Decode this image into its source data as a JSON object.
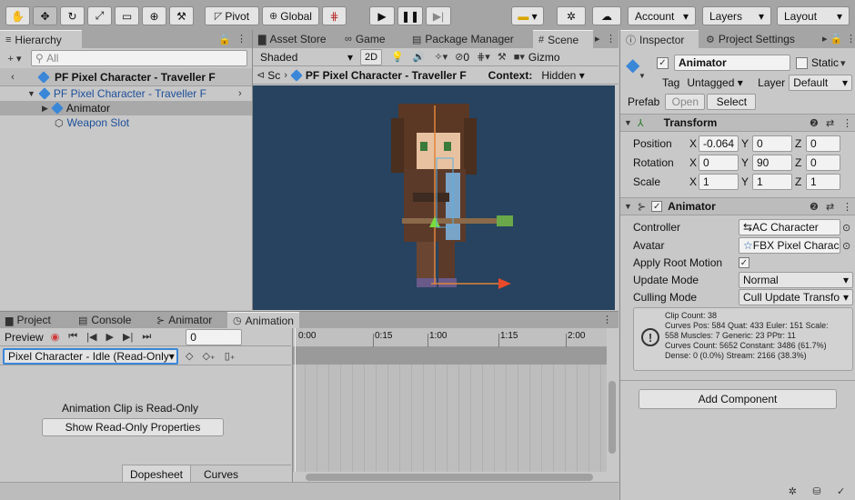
{
  "toolbar": {
    "pivot": "Pivot",
    "global": "Global",
    "account": "Account",
    "layers": "Layers",
    "layout": "Layout"
  },
  "hierarchy": {
    "tab": "Hierarchy",
    "search_placeholder": "All",
    "scene_title": "PF Pixel Character - Traveller F",
    "items": [
      {
        "label": "PF Pixel Character - Traveller F"
      },
      {
        "label": "Animator"
      },
      {
        "label": "Weapon Slot"
      }
    ]
  },
  "scene": {
    "tabs": [
      "Asset Store",
      "Game",
      "Package Manager",
      "Scene"
    ],
    "shading": "Shaded",
    "mode_2d": "2D",
    "gizmos": "Gizmo",
    "layer_count": "0",
    "breadcrumb_sc": "Sc",
    "breadcrumb_title": "PF Pixel Character - Traveller F",
    "context_label": "Context:",
    "context_value": "Hidden"
  },
  "inspector": {
    "tabs": [
      "Inspector",
      "Project Settings"
    ],
    "object_name": "Animator",
    "static_label": "Static",
    "tag_label": "Tag",
    "tag_value": "Untagged",
    "layer_label": "Layer",
    "layer_value": "Default",
    "prefab_label": "Prefab",
    "open_label": "Open",
    "select_label": "Select",
    "transform": {
      "title": "Transform",
      "rows": [
        {
          "label": "Position",
          "x": "-0.064",
          "y": "0",
          "z": "0"
        },
        {
          "label": "Rotation",
          "x": "0",
          "y": "90",
          "z": "0"
        },
        {
          "label": "Scale",
          "x": "1",
          "y": "1",
          "z": "1"
        }
      ]
    },
    "animator": {
      "title": "Animator",
      "controller_label": "Controller",
      "controller_value": "AC Character",
      "avatar_label": "Avatar",
      "avatar_value": "FBX Pixel Charac",
      "root_motion_label": "Apply Root Motion",
      "update_label": "Update Mode",
      "update_value": "Normal",
      "culling_label": "Culling Mode",
      "culling_value": "Cull Update Transfo",
      "info": [
        "Clip Count: 38",
        "Curves Pos: 584 Quat: 433 Euler: 151 Scale:",
        "558 Muscles: 7 Generic: 23 PPtr: 11",
        "Curves Count: 5652 Constant: 3486 (61.7%)",
        "Dense: 0 (0.0%) Stream: 2166 (38.3%)"
      ]
    },
    "add_component": "Add Component"
  },
  "bottom": {
    "tabs": [
      "Project",
      "Console",
      "Animator",
      "Animation"
    ],
    "preview_label": "Preview",
    "frame_value": "0",
    "clip_name": "Pixel Character - Idle (Read-Only",
    "read_only_msg": "Animation Clip is Read-Only",
    "show_props": "Show Read-Only Properties",
    "dopesheet": "Dopesheet",
    "curves": "Curves",
    "ticks": [
      "0:00",
      "0:15",
      "1:00",
      "1:15",
      "2:00"
    ]
  }
}
